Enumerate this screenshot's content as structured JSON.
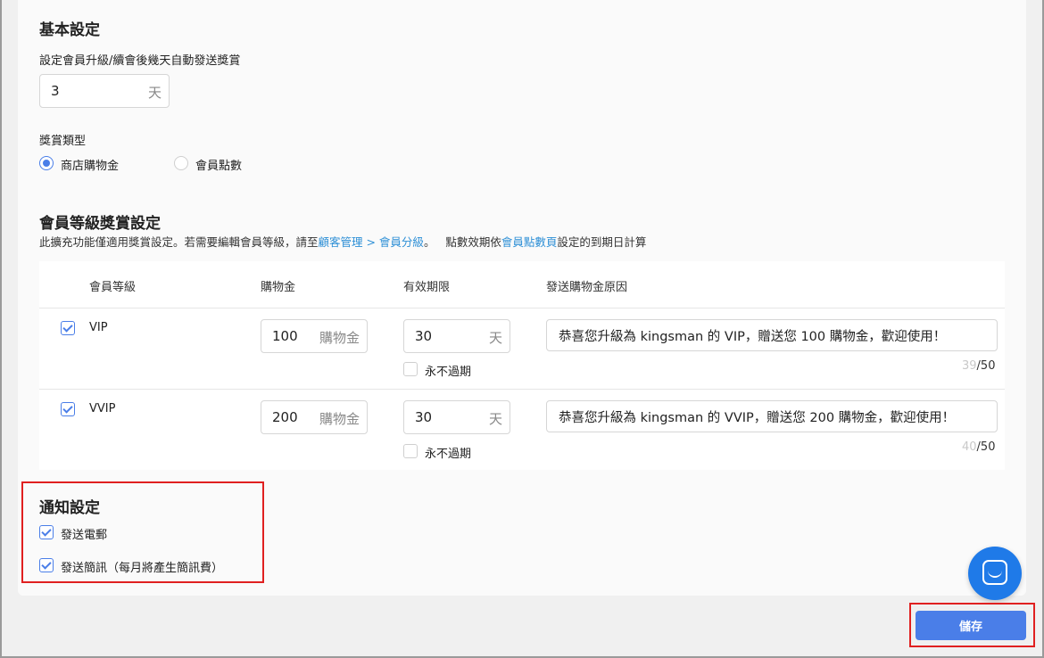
{
  "basic": {
    "title": "基本設定",
    "days_label": "設定會員升級/續會後幾天自動發送獎賞",
    "days_value": "3",
    "days_suffix": "天",
    "reward_type_label": "獎賞類型",
    "reward_options": [
      {
        "label": "商店購物金",
        "selected": true
      },
      {
        "label": "會員點數",
        "selected": false
      }
    ]
  },
  "tier": {
    "title": "會員等級獎賞設定",
    "desc_prefix": "此擴充功能僅適用獎賞設定。若需要編輯會員等級，請至",
    "desc_link": "顧客管理 > 會員分級",
    "desc_mid": "。   點數效期依",
    "desc_link2": "會員點數頁",
    "desc_suffix": "設定的到期日計算",
    "headers": [
      "會員等級",
      "購物金",
      "有效期限",
      "發送購物金原因"
    ],
    "rows": [
      {
        "checked": true,
        "name": "VIP",
        "credit": "100",
        "credit_suffix": "購物金",
        "validity": "30",
        "validity_suffix": "天",
        "never_expire": "永不過期",
        "reason": "恭喜您升級為 kingsman 的 VIP，贈送您 100 購物金，歡迎使用！",
        "count": "39",
        "max": "/50"
      },
      {
        "checked": true,
        "name": "VVIP",
        "credit": "200",
        "credit_suffix": "購物金",
        "validity": "30",
        "validity_suffix": "天",
        "never_expire": "永不過期",
        "reason": "恭喜您升級為 kingsman 的 VVIP，贈送您 200 購物金，歡迎使用！",
        "count": "40",
        "max": "/50"
      }
    ]
  },
  "notify": {
    "title": "通知設定",
    "email": "發送電郵",
    "sms": "發送簡訊（每月將產生簡訊費）"
  },
  "save_label": "儲存",
  "colors": {
    "accent": "#4a7ee8",
    "link": "#2d8fd6",
    "highlight": "#e02020",
    "chat": "#1f7ae8"
  }
}
